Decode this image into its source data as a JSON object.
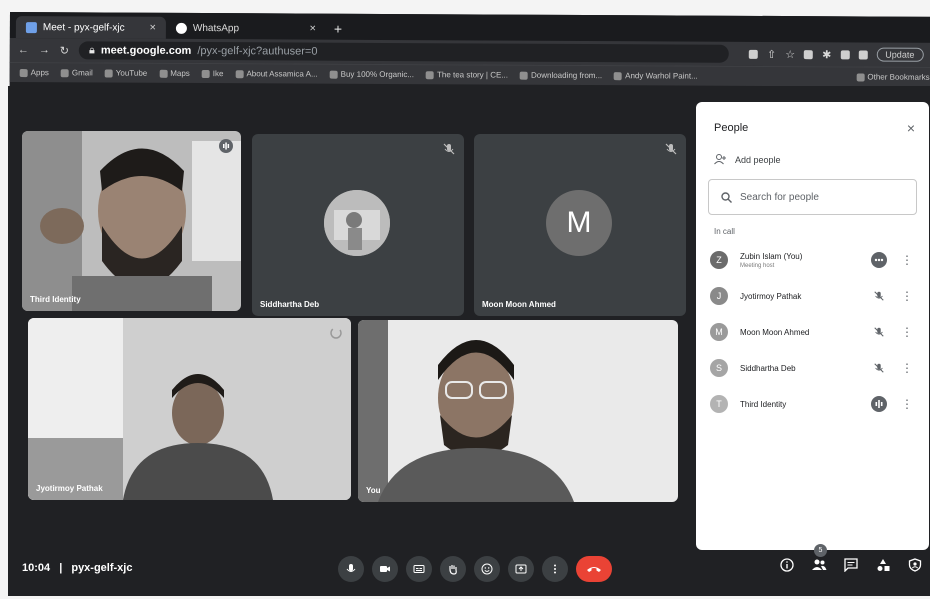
{
  "browser": {
    "tabs": [
      {
        "title": "Meet - pyx-gelf-xjc",
        "active": true
      },
      {
        "title": "WhatsApp",
        "active": false
      }
    ],
    "new_tab": "+",
    "url_host": "meet.google.com",
    "url_path": "/pyx-gelf-xjc?authuser=0",
    "update_label": "Update",
    "bookmarks": [
      "Apps",
      "Gmail",
      "YouTube",
      "Maps",
      "Ike",
      "About Assamica A...",
      "Buy 100% Organic...",
      "The tea story | CE...",
      "Downloading from...",
      "Andy Warhol Paint..."
    ],
    "other_bookmarks": "Other Bookmarks"
  },
  "meet": {
    "time": "10:04",
    "separator": "|",
    "meeting_code": "pyx-gelf-xjc",
    "participant_count": "5",
    "accent_end_call": "#ea4335",
    "tiles": {
      "third_identity": "Third Identity",
      "siddhartha": "Siddhartha Deb",
      "moon": "Moon Moon Ahmed",
      "moon_initial": "M",
      "jyotirmoy": "Jyotirmoy Pathak",
      "you": "You"
    }
  },
  "panel": {
    "title": "People",
    "close": "×",
    "add_people": "Add people",
    "search_placeholder": "Search for people",
    "in_call": "In call",
    "people": [
      {
        "name": "Zubin Islam (You)",
        "sub": "Meeting host",
        "initial": "Z",
        "status_icon": "more-speaking-icon"
      },
      {
        "name": "Jyotirmoy Pathak",
        "sub": "",
        "initial": "J",
        "status_icon": "mic-off-icon"
      },
      {
        "name": "Moon Moon Ahmed",
        "sub": "",
        "initial": "M",
        "status_icon": "mic-off-icon"
      },
      {
        "name": "Siddhartha Deb",
        "sub": "",
        "initial": "S",
        "status_icon": "mic-off-icon"
      },
      {
        "name": "Third Identity",
        "sub": "",
        "initial": "T",
        "status_icon": "speaking-icon"
      }
    ]
  }
}
